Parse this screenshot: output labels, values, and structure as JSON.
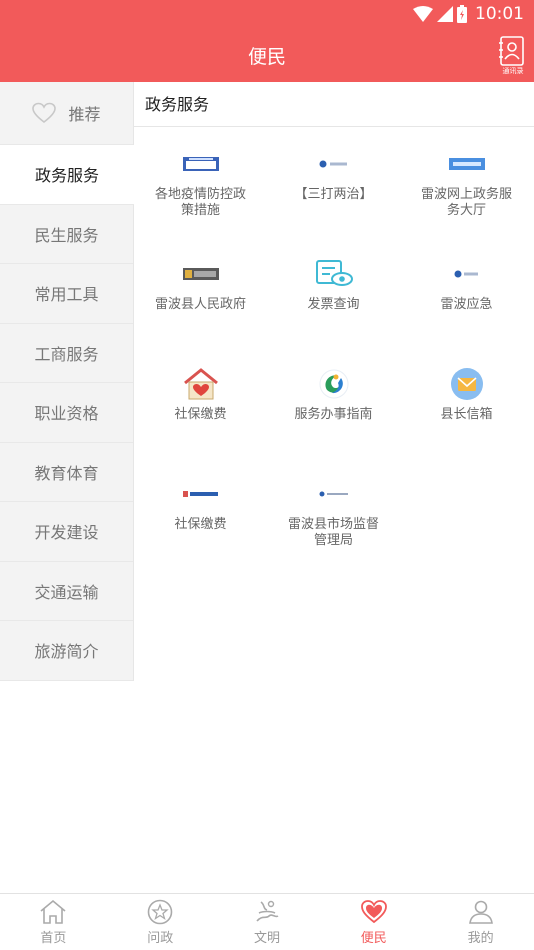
{
  "status_bar": {
    "time": "10:01"
  },
  "header": {
    "title": "便民",
    "contact_label": "通讯录"
  },
  "sidebar": {
    "items": [
      {
        "label": "推荐",
        "icon": "heart-outline-icon"
      },
      {
        "label": "政务服务"
      },
      {
        "label": "民生服务"
      },
      {
        "label": "常用工具"
      },
      {
        "label": "工商服务"
      },
      {
        "label": "职业资格"
      },
      {
        "label": "教育体育"
      },
      {
        "label": "开发建设"
      },
      {
        "label": "交通运输"
      },
      {
        "label": "旅游简介"
      }
    ],
    "active_index": 1
  },
  "content": {
    "section_title": "政务服务",
    "services": [
      {
        "label": "各地疫情防控政策措施",
        "icon": "policy-banner-icon"
      },
      {
        "label": "【三打两治】",
        "icon": "sandaliangzhi-logo-icon"
      },
      {
        "label": "雷波网上政务服务大厅",
        "icon": "online-hall-banner-icon"
      },
      {
        "label": "雷波县人民政府",
        "icon": "gov-banner-icon"
      },
      {
        "label": "发票查询",
        "icon": "invoice-eye-icon"
      },
      {
        "label": "雷波应急",
        "icon": "emergency-logo-icon"
      },
      {
        "label": "社保缴费",
        "icon": "house-heart-icon"
      },
      {
        "label": "服务办事指南",
        "icon": "guide-swirl-icon"
      },
      {
        "label": "县长信箱",
        "icon": "envelope-icon"
      },
      {
        "label": "社保缴费",
        "icon": "social-banner-icon"
      },
      {
        "label": "雷波县市场监督管理局",
        "icon": "market-banner-icon"
      }
    ]
  },
  "tabbar": {
    "tabs": [
      {
        "label": "首页",
        "icon": "home-icon"
      },
      {
        "label": "问政",
        "icon": "star-circle-icon"
      },
      {
        "label": "文明",
        "icon": "culture-icon"
      },
      {
        "label": "便民",
        "icon": "heart-icon"
      },
      {
        "label": "我的",
        "icon": "user-icon"
      }
    ],
    "active_index": 3
  },
  "colors": {
    "primary": "#f25a5a",
    "sidebar_bg": "#f3f3f3",
    "text_gray": "#666666"
  }
}
